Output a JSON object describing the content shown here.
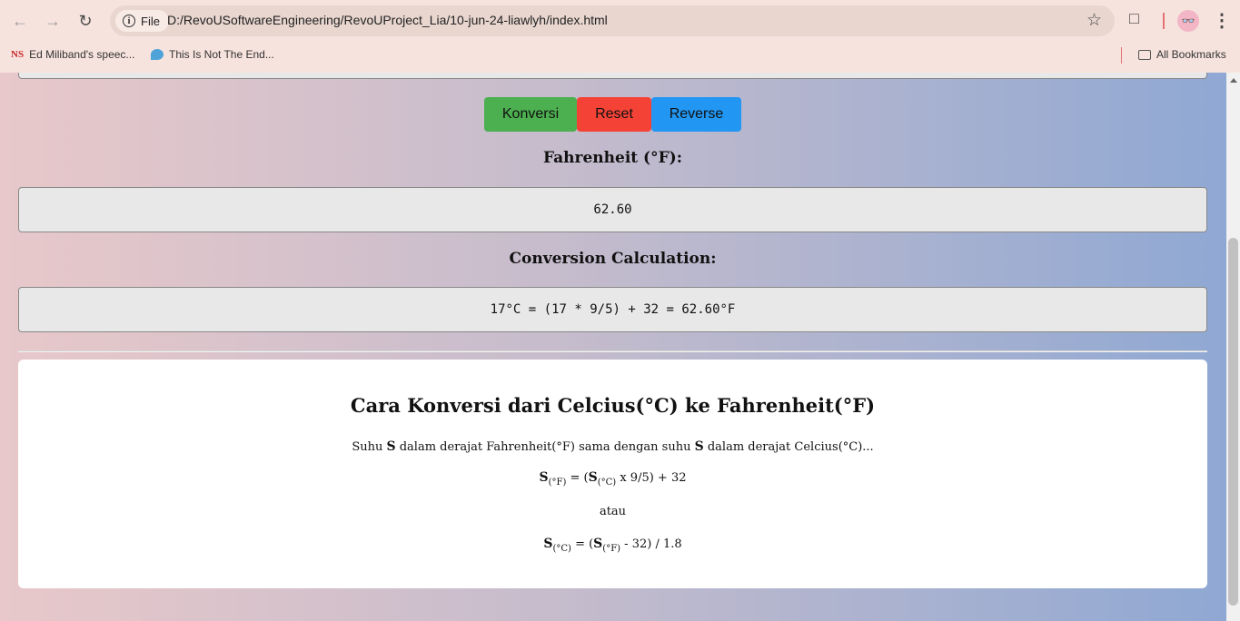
{
  "browser": {
    "chip_label": "File",
    "url": "D:/RevoUSoftwareEngineering/RevoUProject_Lia/10-jun-24-liawlyh/index.html",
    "bookmarks": [
      {
        "icon": "NS",
        "label": "Ed Miliband's speec..."
      },
      {
        "label": "This Is Not The End..."
      }
    ],
    "all_bookmarks": "All Bookmarks"
  },
  "buttons": {
    "konversi": "Konversi",
    "reset": "Reset",
    "reverse": "Reverse"
  },
  "result": {
    "label": "Fahrenheit (°F):",
    "value": "62.60"
  },
  "calculation": {
    "label": "Conversion Calculation:",
    "value": "17°C = (17 * 9/5) + 32 = 62.60°F"
  },
  "info": {
    "title": "Cara Konversi dari Celcius(°C) ke Fahrenheit(°F)",
    "intro_pre": "Suhu ",
    "intro_s1": "S",
    "intro_mid": " dalam derajat Fahrenheit(°F) sama dengan suhu ",
    "intro_s2": "S",
    "intro_post": " dalam derajat Celcius(°C)...",
    "formula1": {
      "s": "S",
      "sub1": "(°F)",
      "eq": " = (",
      "s2": "S",
      "sub2": "(°C)",
      "rest": " x 9/5) + 32"
    },
    "or": "atau",
    "formula2": {
      "s": "S",
      "sub1": "(°C)",
      "eq": " = (",
      "s2": "S",
      "sub2": "(°F)",
      "rest": " - 32) / 1.8"
    }
  }
}
